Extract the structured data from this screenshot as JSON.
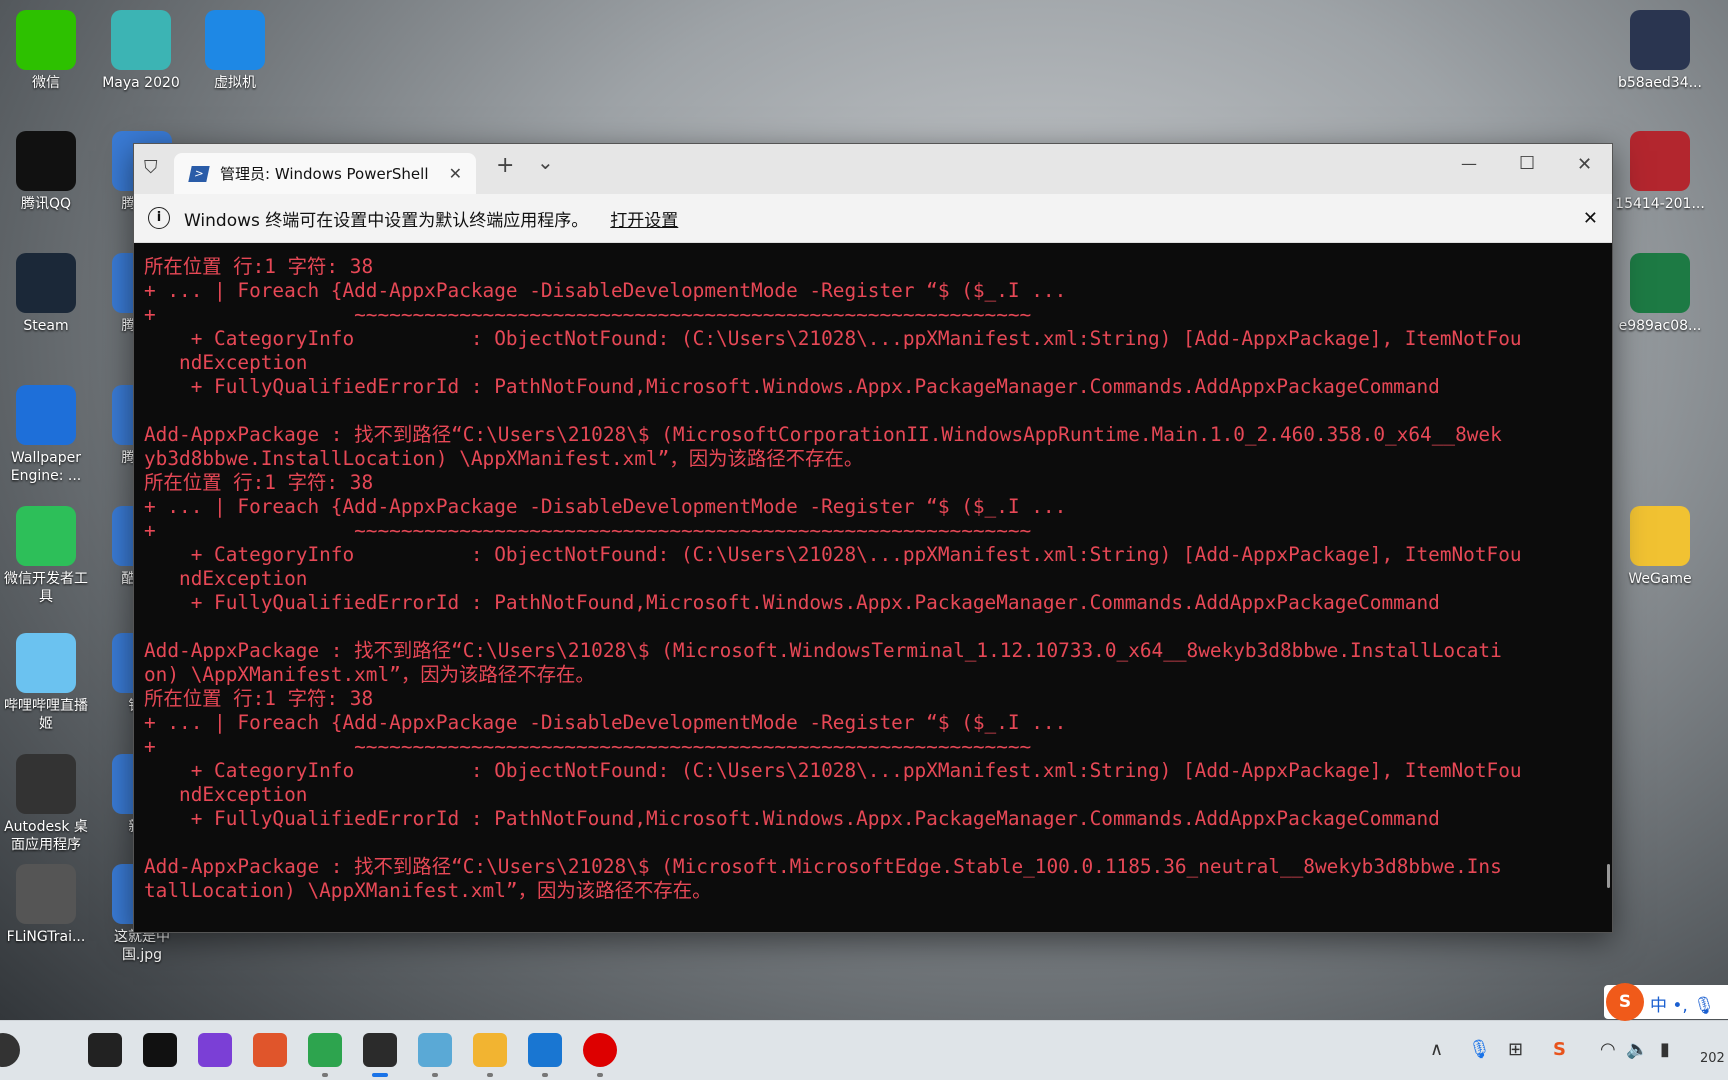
{
  "desktop": {
    "left_icons": [
      "微信",
      "腾讯QQ",
      "Steam",
      "Wallpaper Engine: ...",
      "微信开发者工具",
      "哔哩哔哩直播姬",
      "Autodesk 桌面应用程序",
      "FLiNGTrai..."
    ],
    "second_column": [
      "腾讯...",
      "腾讯...",
      "腾讯...",
      "酷狗...",
      "钉...",
      "新...",
      "这就是中国.jpg"
    ],
    "top_icons": [
      "Maya 2020",
      "虚拟机"
    ],
    "right_icons": [
      "b58aed34...",
      "15414-201...",
      "e989ac08...",
      "WeGame"
    ]
  },
  "window": {
    "tab_title": "管理员: Windows PowerShell",
    "new_tab": "+",
    "dropdown": "⌄",
    "minimize": "—",
    "maximize": "☐",
    "close": "✕",
    "info_message": "Windows 终端可在设置中设置为默认终端应用程序。",
    "info_link": "打开设置",
    "lines": [
      "所在位置 行:1 字符: 38",
      "+ ... | Foreach {Add-AppxPackage -DisableDevelopmentMode -Register “$ ($_.I ...",
      "+                 ~~~~~~~~~~~~~~~~~~~~~~~~~~~~~~~~~~~~~~~~~~~~~~~~~~~~~~~~~~",
      "    + CategoryInfo          : ObjectNotFound: (C:\\Users\\21028\\...ppXManifest.xml:String) [Add-AppxPackage], ItemNotFou",
      "   ndException",
      "    + FullyQualifiedErrorId : PathNotFound,Microsoft.Windows.Appx.PackageManager.Commands.AddAppxPackageCommand",
      "",
      "Add-AppxPackage : 找不到路径“C:\\Users\\21028\\$ (MicrosoftCorporationII.WindowsAppRuntime.Main.1.0_2.460.358.0_x64__8wek",
      "yb3d8bbwe.InstallLocation) \\AppXManifest.xml”，因为该路径不存在。",
      "所在位置 行:1 字符: 38",
      "+ ... | Foreach {Add-AppxPackage -DisableDevelopmentMode -Register “$ ($_.I ...",
      "+                 ~~~~~~~~~~~~~~~~~~~~~~~~~~~~~~~~~~~~~~~~~~~~~~~~~~~~~~~~~~",
      "    + CategoryInfo          : ObjectNotFound: (C:\\Users\\21028\\...ppXManifest.xml:String) [Add-AppxPackage], ItemNotFou",
      "   ndException",
      "    + FullyQualifiedErrorId : PathNotFound,Microsoft.Windows.Appx.PackageManager.Commands.AddAppxPackageCommand",
      "",
      "Add-AppxPackage : 找不到路径“C:\\Users\\21028\\$ (Microsoft.WindowsTerminal_1.12.10733.0_x64__8wekyb3d8bbwe.InstallLocati",
      "on) \\AppXManifest.xml”，因为该路径不存在。",
      "所在位置 行:1 字符: 38",
      "+ ... | Foreach {Add-AppxPackage -DisableDevelopmentMode -Register “$ ($_.I ...",
      "+                 ~~~~~~~~~~~~~~~~~~~~~~~~~~~~~~~~~~~~~~~~~~~~~~~~~~~~~~~~~~",
      "    + CategoryInfo          : ObjectNotFound: (C:\\Users\\21028\\...ppXManifest.xml:String) [Add-AppxPackage], ItemNotFou",
      "   ndException",
      "    + FullyQualifiedErrorId : PathNotFound,Microsoft.Windows.Appx.PackageManager.Commands.AddAppxPackageCommand",
      "",
      "Add-AppxPackage : 找不到路径“C:\\Users\\21028\\$ (Microsoft.MicrosoftEdge.Stable_100.0.1185.36_neutral__8wekyb3d8bbwe.Ins",
      "tallLocation) \\AppXManifest.xml”，因为该路径不存在。"
    ],
    "error_color": "#e74856"
  },
  "taskbar": {
    "apps": [
      "search",
      "task-view",
      "xbox",
      "app-purple",
      "hbuilder",
      "chrome",
      "terminal",
      "notepad",
      "file-explorer",
      "defender",
      "recorder"
    ],
    "ime": "中",
    "clock": "202"
  }
}
